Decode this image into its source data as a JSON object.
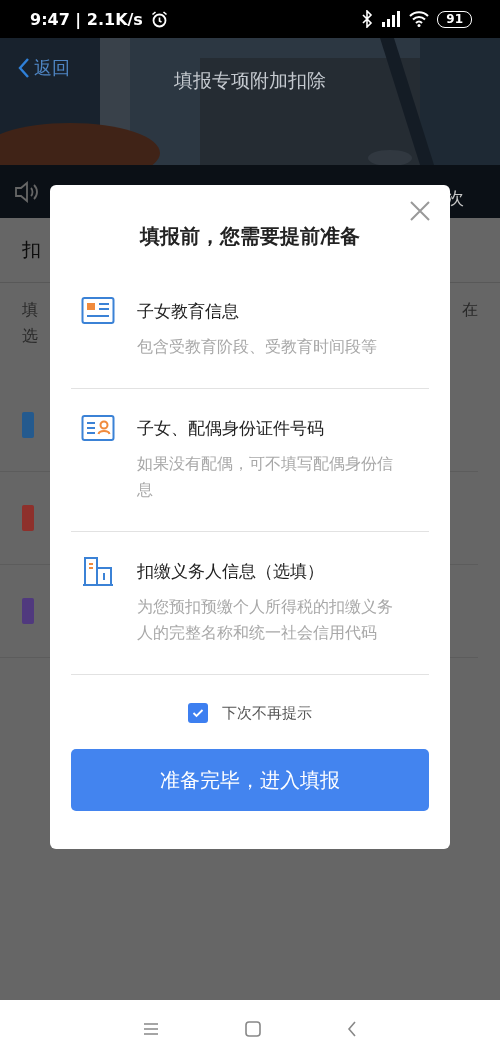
{
  "status_bar": {
    "text": "9:47 | 2.1K/s",
    "battery": "91"
  },
  "header": {
    "back": "返回",
    "title": "填报专项附加扣除"
  },
  "notice": {
    "text": "次"
  },
  "page": {
    "section_title": "扣",
    "intro_left": [
      "填",
      "选"
    ],
    "intro_right": "在",
    "items": [
      {
        "color": "#245a8e"
      },
      {
        "color": "#8e302b"
      },
      {
        "color": "#50397e"
      }
    ]
  },
  "dialog": {
    "title": "填报前，您需要提前准备",
    "items": [
      {
        "kind": "education",
        "title": "子女教育信息",
        "description": "包含受教育阶段、受教育时间段等"
      },
      {
        "kind": "id-card",
        "title": "子女、配偶身份证件号码",
        "description": "如果没有配偶，可不填写配偶身份信息"
      },
      {
        "kind": "building",
        "title": "扣缴义务人信息（选填）",
        "description": "为您预扣预缴个人所得税的扣缴义务人的完整名称和统一社会信用代码"
      }
    ],
    "checkbox": {
      "label": "下次不再提示",
      "checked": true
    },
    "button": "准备完毕，进入填报"
  }
}
